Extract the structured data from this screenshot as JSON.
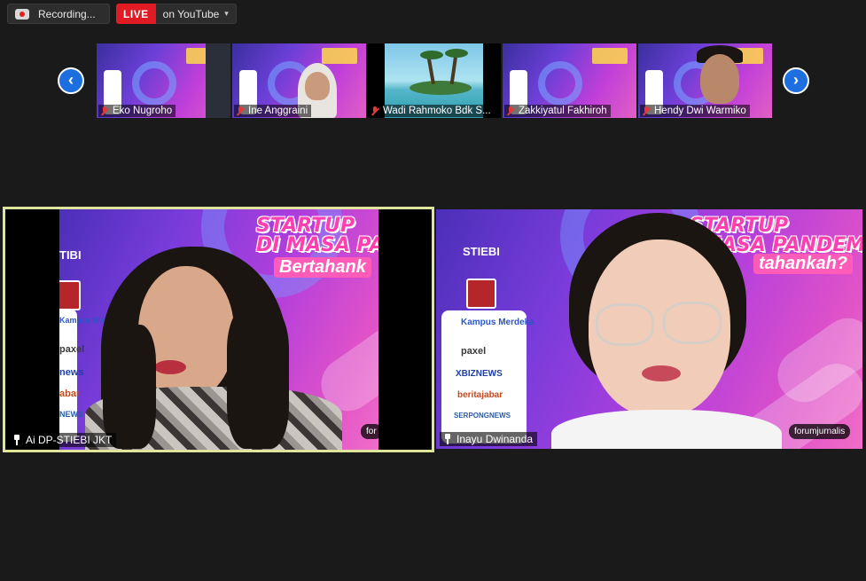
{
  "toolbar": {
    "recording_label": "Recording...",
    "live_label": "LIVE",
    "live_destination": "on YouTube",
    "caret": "▾"
  },
  "gallery": {
    "prev_icon": "‹",
    "next_icon": "›",
    "participants": [
      {
        "name": "Eko Nugroho",
        "muted": true
      },
      {
        "name": "Ine Anggraini",
        "muted": true
      },
      {
        "name": "Wadi Rahmoko Bdk S...",
        "muted": true
      },
      {
        "name": "Zakkiyatul Fakhiroh",
        "muted": true
      },
      {
        "name": "Hendy Dwi Warmiko",
        "muted": true
      }
    ]
  },
  "speakers": {
    "left": {
      "name": "Ai DP-STIEBI JKT",
      "slide_title_1": "STARTUP",
      "slide_title_2": "DI MASA PAN",
      "slide_sub": "Bertahank",
      "watermark": "for",
      "sponsors": [
        "Kampus Merdeka",
        "paxel",
        "news",
        "abar",
        "NEWS"
      ],
      "badge_text": "TIBI"
    },
    "right": {
      "name": "Inayu Dwinanda",
      "slide_title_1": "STARTUP",
      "slide_title_2": "MASA PANDEMI",
      "slide_sub": "tahankah?",
      "watermark": "forumjurnalis",
      "stiebi": "STIEBI",
      "sponsors": [
        "Kampus Merdeka",
        "paxel",
        "XBIZNEWS",
        "beritajabar",
        "SERPONGNEWS"
      ]
    }
  },
  "colors": {
    "live_red": "#e01b24",
    "active_speaker_border": "#e1e59b",
    "nav_blue": "#1d6fe0",
    "background": "#1a1a1a"
  }
}
